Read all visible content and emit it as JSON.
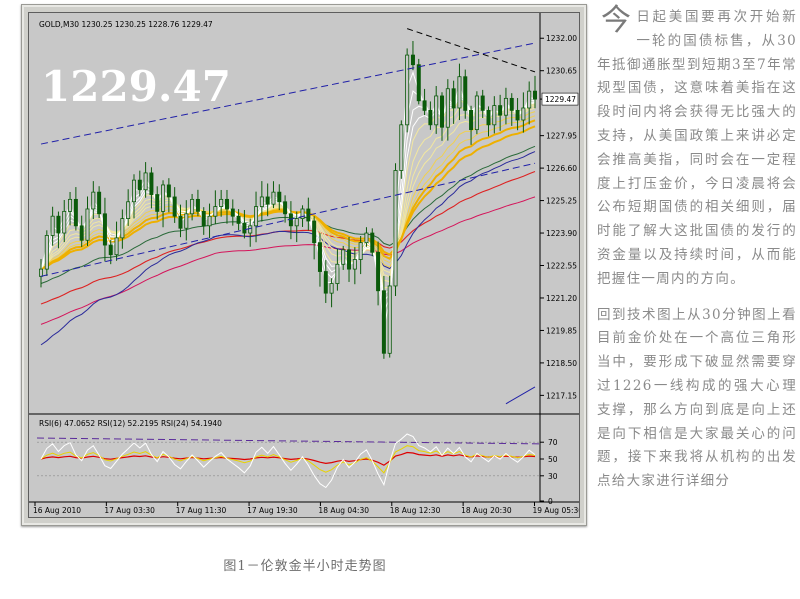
{
  "chart_data": [
    {
      "type": "candlestick",
      "title": "GOLD,M30  1230.25 1230.25 1228.76 1229.47",
      "overlay_price": "1229.47",
      "price_marker": "1229.47",
      "ylim": [
        1216.5,
        1232.8
      ],
      "y_ticks": [
        "1232.00",
        "1230.65",
        "1229.47",
        "1227.95",
        "1226.60",
        "1225.25",
        "1223.90",
        "1222.55",
        "1221.20",
        "1219.85",
        "1218.50",
        "1217.15"
      ],
      "x_ticks": [
        "16 Aug 2010",
        "17 Aug 03:30",
        "17 Aug 11:30",
        "17 Aug 19:30",
        "18 Aug 04:30",
        "18 Aug 12:30",
        "18 Aug 20:30",
        "19 Aug 05:30"
      ],
      "close_series": [
        1222.4,
        1223.8,
        1224.6,
        1223.9,
        1224.8,
        1225.3,
        1224.2,
        1223.6,
        1224.9,
        1225.6,
        1224.7,
        1223.4,
        1223.0,
        1223.7,
        1224.5,
        1225.2,
        1226.1,
        1225.7,
        1226.4,
        1225.5,
        1224.8,
        1225.9,
        1225.4,
        1224.6,
        1224.1,
        1224.7,
        1225.3,
        1224.8,
        1224.2,
        1224.6,
        1225.0,
        1225.3,
        1224.9,
        1224.6,
        1224.3,
        1223.9,
        1224.2,
        1225.0,
        1225.4,
        1225.1,
        1225.6,
        1225.2,
        1224.7,
        1224.2,
        1224.5,
        1224.9,
        1224.4,
        1223.5,
        1222.3,
        1221.4,
        1221.8,
        1222.6,
        1223.2,
        1222.4,
        1222.8,
        1223.5,
        1223.9,
        1223.1,
        1221.5,
        1218.9,
        1221.7,
        1226.5,
        1228.4,
        1231.3,
        1230.9,
        1229.4,
        1229.0,
        1228.4,
        1229.6,
        1228.3,
        1229.9,
        1229.1,
        1230.4,
        1229.0,
        1228.2,
        1229.6,
        1229.0,
        1228.4,
        1229.2,
        1228.8,
        1229.5,
        1229.0,
        1228.6,
        1229.1,
        1229.8,
        1229.47
      ],
      "trendlines": "two blue dashed channel lines and a black dashed triangle top line",
      "moving_averages": "white, yellow and orange ribbon of moving averages with green, red, crimson and blue longer averages"
    },
    {
      "type": "line",
      "title": "RSI(6) 47.0652  RSI(12) 52.2195  RSI(24) 54.1940",
      "ylim": [
        0,
        100
      ],
      "y_ticks": [
        "70",
        "50",
        "30",
        "0"
      ],
      "series": [
        {
          "name": "RSI(6)",
          "value": "47.0652",
          "color": "#ffffff"
        },
        {
          "name": "RSI(12)",
          "value": "52.2195",
          "color": "#e8d300"
        },
        {
          "name": "RSI(24)",
          "value": "54.1940",
          "color": "#dd0000"
        }
      ]
    }
  ],
  "caption": "图1－伦敦金半小时走势图",
  "article": {
    "dropcap": "今",
    "paragraph1": "日起美国要再次开始新一轮的国债标售，从30年抵御通胀型到短期3至7年常规型国债，这意味着美指在这段时间内将会获得无比强大的支持，从美国政策上来讲必定会推高美指，同时会在一定程度上打压金价，今日凌晨将会公布短期国债的相关细则，届时能了解大这批国债的发行的资金量以及持续时间，从而能把握住一周内的方向。",
    "paragraph2": "回到技术图上从30分钟图上看目前金价处在一个高位三角形当中，要形成下破显然需要穿过1226一线构成的强大心理支撑，那么方向到底是向上还是向下相信是大家最关心的问题，接下来我将从机构的出发点给大家进行详细分"
  },
  "colors": {
    "plot_bg": "#c8c8c8",
    "frame": "#d0d0cb",
    "candle": "#0b5a0b",
    "channel": "#2020a8",
    "text_grey": "#8a8a8a"
  }
}
